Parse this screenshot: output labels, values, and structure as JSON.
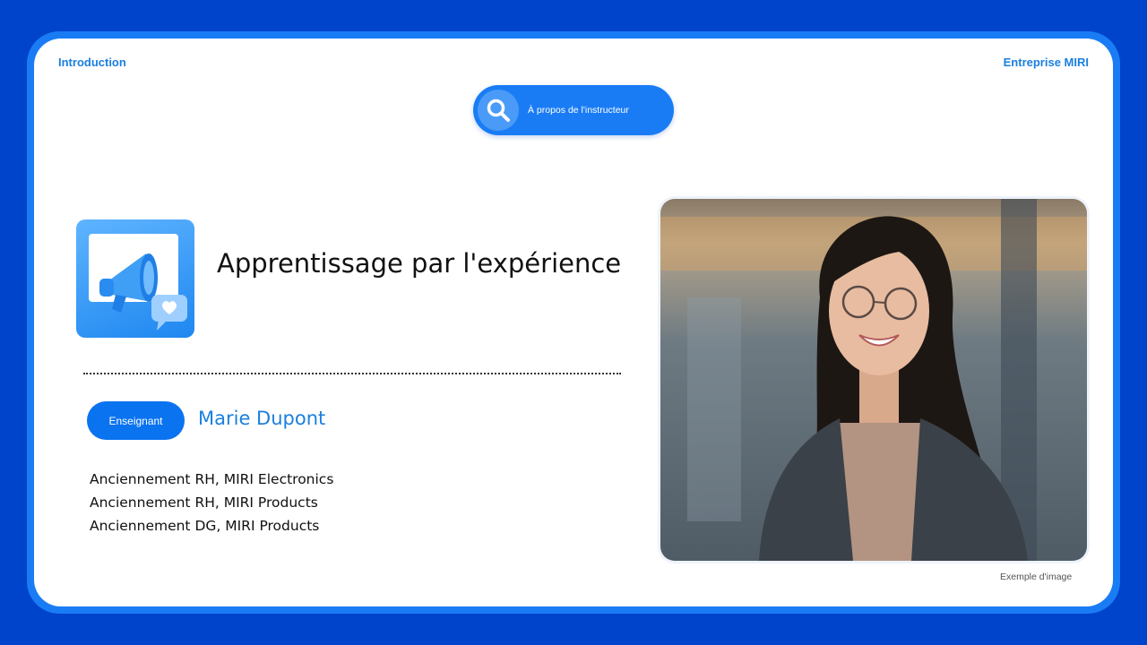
{
  "header": {
    "left_label": "Introduction",
    "right_label": "Entreprise MIRI"
  },
  "search_pill": {
    "label": "À propos de l'instructeur",
    "icon": "search-icon"
  },
  "app_icon": "megaphone-icon",
  "main": {
    "title": "Apprentissage par l'expérience"
  },
  "instructor": {
    "badge": "Enseignant",
    "name": "Marie Dupont",
    "roles": [
      "Anciennement RH, MIRI Electronics",
      "Anciennement RH, MIRI Products",
      "Anciennement DG, MIRI Products"
    ]
  },
  "photo": {
    "caption": "Exemple d'image"
  },
  "colors": {
    "background": "#0044cc",
    "accent": "#1a7cf5",
    "name": "#1a7fdf"
  }
}
